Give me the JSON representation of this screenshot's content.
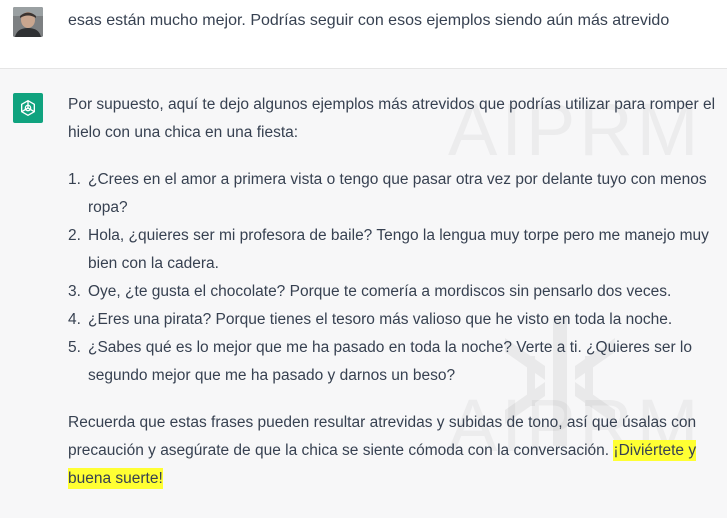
{
  "user_message": {
    "text": "esas están mucho mejor. Podrías seguir con esos ejemplos siendo aún más atrevido"
  },
  "assistant_message": {
    "intro": "Por supuesto, aquí te dejo algunos ejemplos más atrevidos que podrías utilizar para romper el hielo con una chica en una fiesta:",
    "items": [
      {
        "number": "1.",
        "text": "¿Crees en el amor a primera vista o tengo que pasar otra vez por delante tuyo con menos ropa?"
      },
      {
        "number": "2.",
        "text": "Hola, ¿quieres ser mi profesora de baile? Tengo la lengua muy torpe pero me manejo muy bien con la cadera."
      },
      {
        "number": "3.",
        "text": "Oye, ¿te gusta el chocolate? Porque te comería a mordiscos sin pensarlo dos veces."
      },
      {
        "number": "4.",
        "text": "¿Eres una pirata? Porque tienes el tesoro más valioso que he visto en toda la noche."
      },
      {
        "number": "5.",
        "text": "¿Sabes qué es lo mejor que me ha pasado en toda la noche? Verte a ti. ¿Quieres ser lo segundo mejor que me ha pasado y darnos un beso?"
      }
    ],
    "closing": "Recuerda que estas frases pueden resultar atrevidas y subidas de tono, así que úsalas con precaución y asegúrate de que la chica se siente cómoda con la conversación.",
    "closing_highlight": "¡Diviértete y buena suerte!"
  },
  "watermark": {
    "text_top": "AIPRM",
    "text_bottom": "AIPRM"
  },
  "colors": {
    "assistant_bg": "#f7f7f8",
    "gpt_icon_bg": "#10a37f",
    "highlight": "#ffff33",
    "text": "#374151"
  },
  "icons": {
    "user_avatar": "user-photo-avatar",
    "assistant_avatar": "openai-logo-icon"
  }
}
